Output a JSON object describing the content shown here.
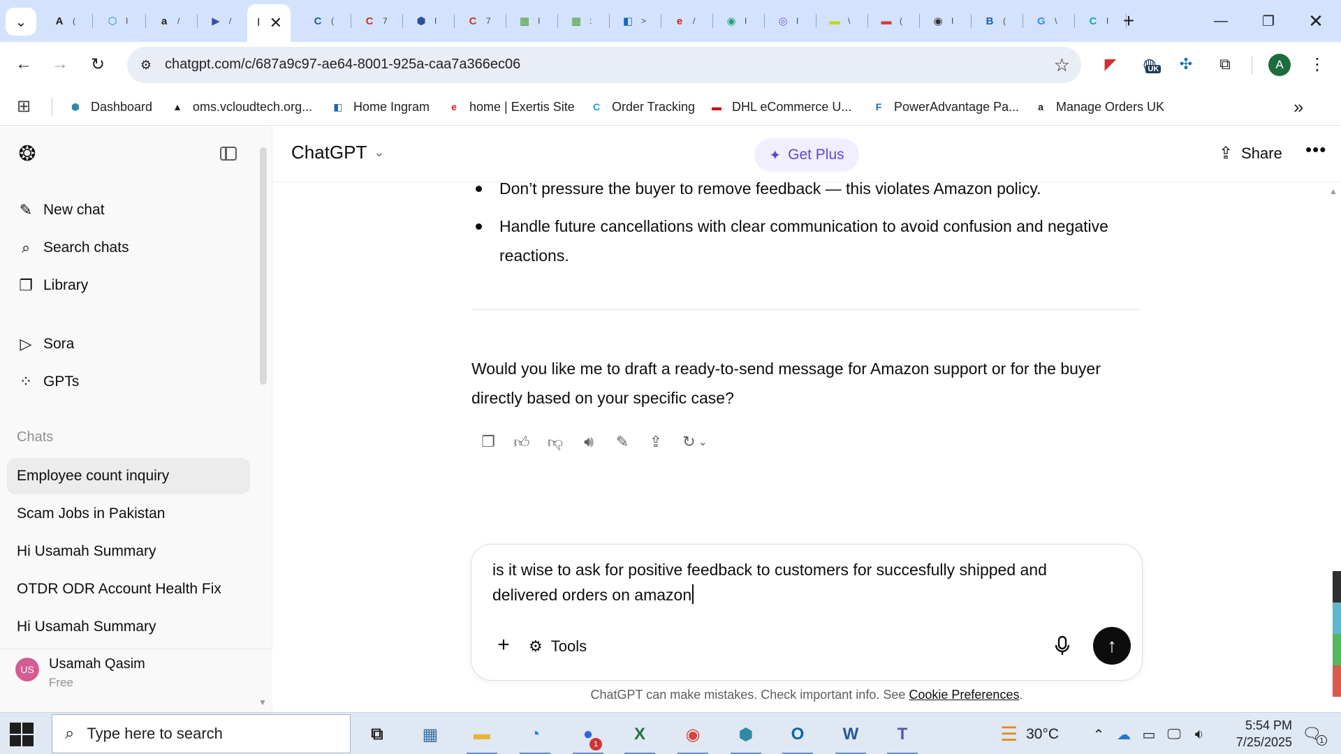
{
  "browser": {
    "tabs": [
      {
        "icon": "A",
        "color": "#1f1f1f",
        "text": "("
      },
      {
        "icon": "⬡",
        "color": "#2f8aa3",
        "text": "I"
      },
      {
        "icon": "a",
        "color": "#1f1f1f",
        "text": "/"
      },
      {
        "icon": "▶",
        "color": "#3b4ea6",
        "text": "/"
      },
      {
        "icon": "C",
        "color": "#1b5fad",
        "text": "("
      },
      {
        "icon": "C",
        "color": "#c0392b",
        "text": "7"
      },
      {
        "icon": "⬢",
        "color": "#2a4f9e",
        "text": "I"
      },
      {
        "icon": "C",
        "color": "#c0392b",
        "text": "7"
      },
      {
        "icon": "▦",
        "color": "#4d9a2e",
        "text": "I"
      },
      {
        "icon": "▦",
        "color": "#4d9a2e",
        "text": ":"
      },
      {
        "icon": "◧",
        "color": "#1565c0",
        "text": ">"
      },
      {
        "icon": "e",
        "color": "#d81e1e",
        "text": "/"
      },
      {
        "icon": "◉",
        "color": "#1aa37a",
        "text": "I"
      },
      {
        "icon": "◎",
        "color": "#7b57c9",
        "text": "I"
      },
      {
        "icon": "▬",
        "color": "#c6d61a",
        "text": "\\"
      },
      {
        "icon": "▬",
        "color": "#d93b3b",
        "text": "("
      },
      {
        "icon": "◉",
        "color": "#333333",
        "text": "I"
      },
      {
        "icon": "B",
        "color": "#1565c0",
        "text": "("
      },
      {
        "icon": "G",
        "color": "#4285f4",
        "text": "\\"
      },
      {
        "icon": "C",
        "color": "#1ba3b8",
        "text": "I"
      }
    ],
    "active_tab_icon": "I",
    "url": "chatgpt.com/c/687a9c97-ae64-8001-925a-caa7a366ec06",
    "profile_initial": "A",
    "ext_uk_badge": "UK",
    "bookmarks": [
      {
        "label": "Dashboard",
        "icon": "⬢",
        "color": "#2f8aa3"
      },
      {
        "label": "oms.vcloudtech.org...",
        "icon": "▲",
        "color": "#1f1f1f"
      },
      {
        "label": "Home Ingram",
        "icon": "◧",
        "color": "#1565c0"
      },
      {
        "label": "home | Exertis Site",
        "icon": "e",
        "color": "#d81e1e"
      },
      {
        "label": "Order Tracking",
        "icon": "C",
        "color": "#1ba3b8"
      },
      {
        "label": "DHL eCommerce U...",
        "icon": "▬",
        "color": "#d40511"
      },
      {
        "label": "PowerAdvantage Pa...",
        "icon": "F",
        "color": "#1565c0"
      },
      {
        "label": "Manage Orders UK",
        "icon": "a",
        "color": "#1f1f1f"
      }
    ]
  },
  "sidebar": {
    "nav": [
      {
        "label": "New chat",
        "icon": "✎"
      },
      {
        "label": "Search chats",
        "icon": "⌕"
      },
      {
        "label": "Library",
        "icon": "❐"
      },
      {
        "label": "Sora",
        "icon": "▷"
      },
      {
        "label": "GPTs",
        "icon": "⁘"
      }
    ],
    "section_label": "Chats",
    "chats": [
      "Employee count inquiry",
      "Scam Jobs in Pakistan",
      "Hi Usamah Summary",
      "OTDR ODR Account Health Fix",
      "Hi Usamah Summary"
    ],
    "user": {
      "initials": "US",
      "name": "Usamah Qasim",
      "plan": "Free"
    }
  },
  "header": {
    "model": "ChatGPT",
    "get_plus": "Get Plus",
    "share": "Share"
  },
  "conversation": {
    "bullets": [
      "Don’t pressure the buyer to remove feedback — this violates Amazon policy.",
      "Handle future cancellations with clear communication to avoid confusion and negative reactions."
    ],
    "closing_question": "Would you like me to draft a ready-to-send message for Amazon support or for the buyer directly based on your specific case?"
  },
  "composer": {
    "value": "is it wise to ask for positive feedback to customers for succesfully shipped and delivered orders on amazon",
    "tools_label": "Tools"
  },
  "disclaimer": {
    "text": "ChatGPT can make mistakes. Check important info. See ",
    "link": "Cookie Preferences",
    "end": "."
  },
  "taskbar": {
    "search_placeholder": "Type here to search",
    "zoom_badge": "1",
    "weather": "30°C",
    "time": "5:54 PM",
    "date": "7/25/2025",
    "notif_count": "1"
  },
  "colors": {
    "accent_plus": "#5a48d9",
    "chrome_tabstrip": "#d3e3fd"
  }
}
